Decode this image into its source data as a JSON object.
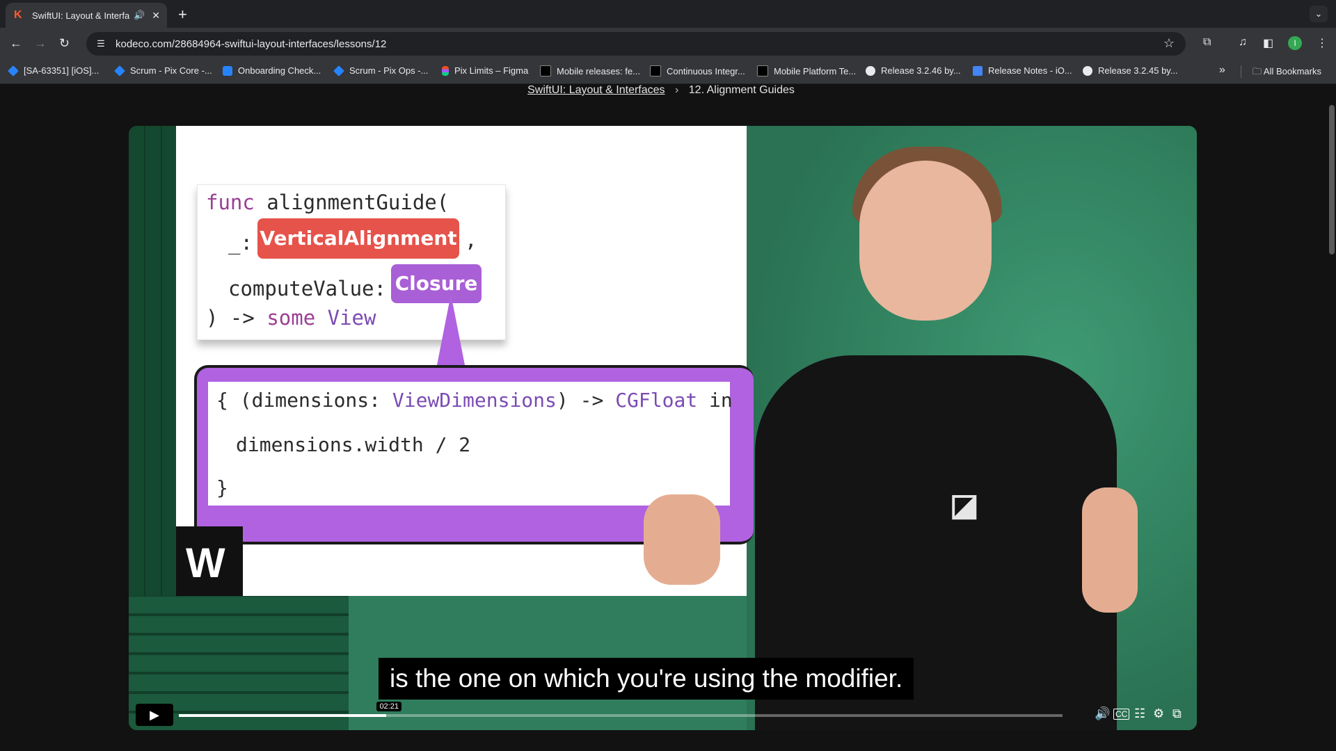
{
  "browser": {
    "tab": {
      "title": "SwiftUI: Layout & Interfac",
      "favicon": "K"
    },
    "url": "kodeco.com/28684964-swiftui-layout-interfaces/lessons/12",
    "profile_initial": "I",
    "bookmarks": [
      "[SA-63351] [iOS]...",
      "Scrum - Pix Core -...",
      "Onboarding Check...",
      "Scrum - Pix Ops -...",
      "Pix Limits – Figma",
      "Mobile releases: fe...",
      "Continuous Integr...",
      "Mobile Platform Te...",
      "Release 3.2.46 by...",
      "Release Notes - iO...",
      "Release 3.2.45 by..."
    ],
    "all_bookmarks_label": "All Bookmarks"
  },
  "breadcrumb": {
    "course": "SwiftUI: Layout & Interfaces",
    "lesson": "12. Alignment Guides"
  },
  "slide": {
    "line1_kw": "func",
    "line1_rest": " alignmentGuide(",
    "line2_prefix": "_:",
    "pill_red": "VerticalAlignment",
    "line2_suffix": ",",
    "line3_prefix": "computeValue:",
    "pill_purple": "Closure",
    "line4_prefix": ") -> ",
    "line4_kw": "some",
    "line4_type": " View",
    "closure_open": "{ (dimensions: ",
    "closure_type1": "ViewDimensions",
    "closure_arrow": ") -> ",
    "closure_type2": "CGFloat",
    "closure_in": " in",
    "closure_body": "dimensions.width / 2",
    "closure_close": "}"
  },
  "video": {
    "caption": "is the one on which you're using the modifier.",
    "current_time": "02:21",
    "progress": 0.235
  }
}
